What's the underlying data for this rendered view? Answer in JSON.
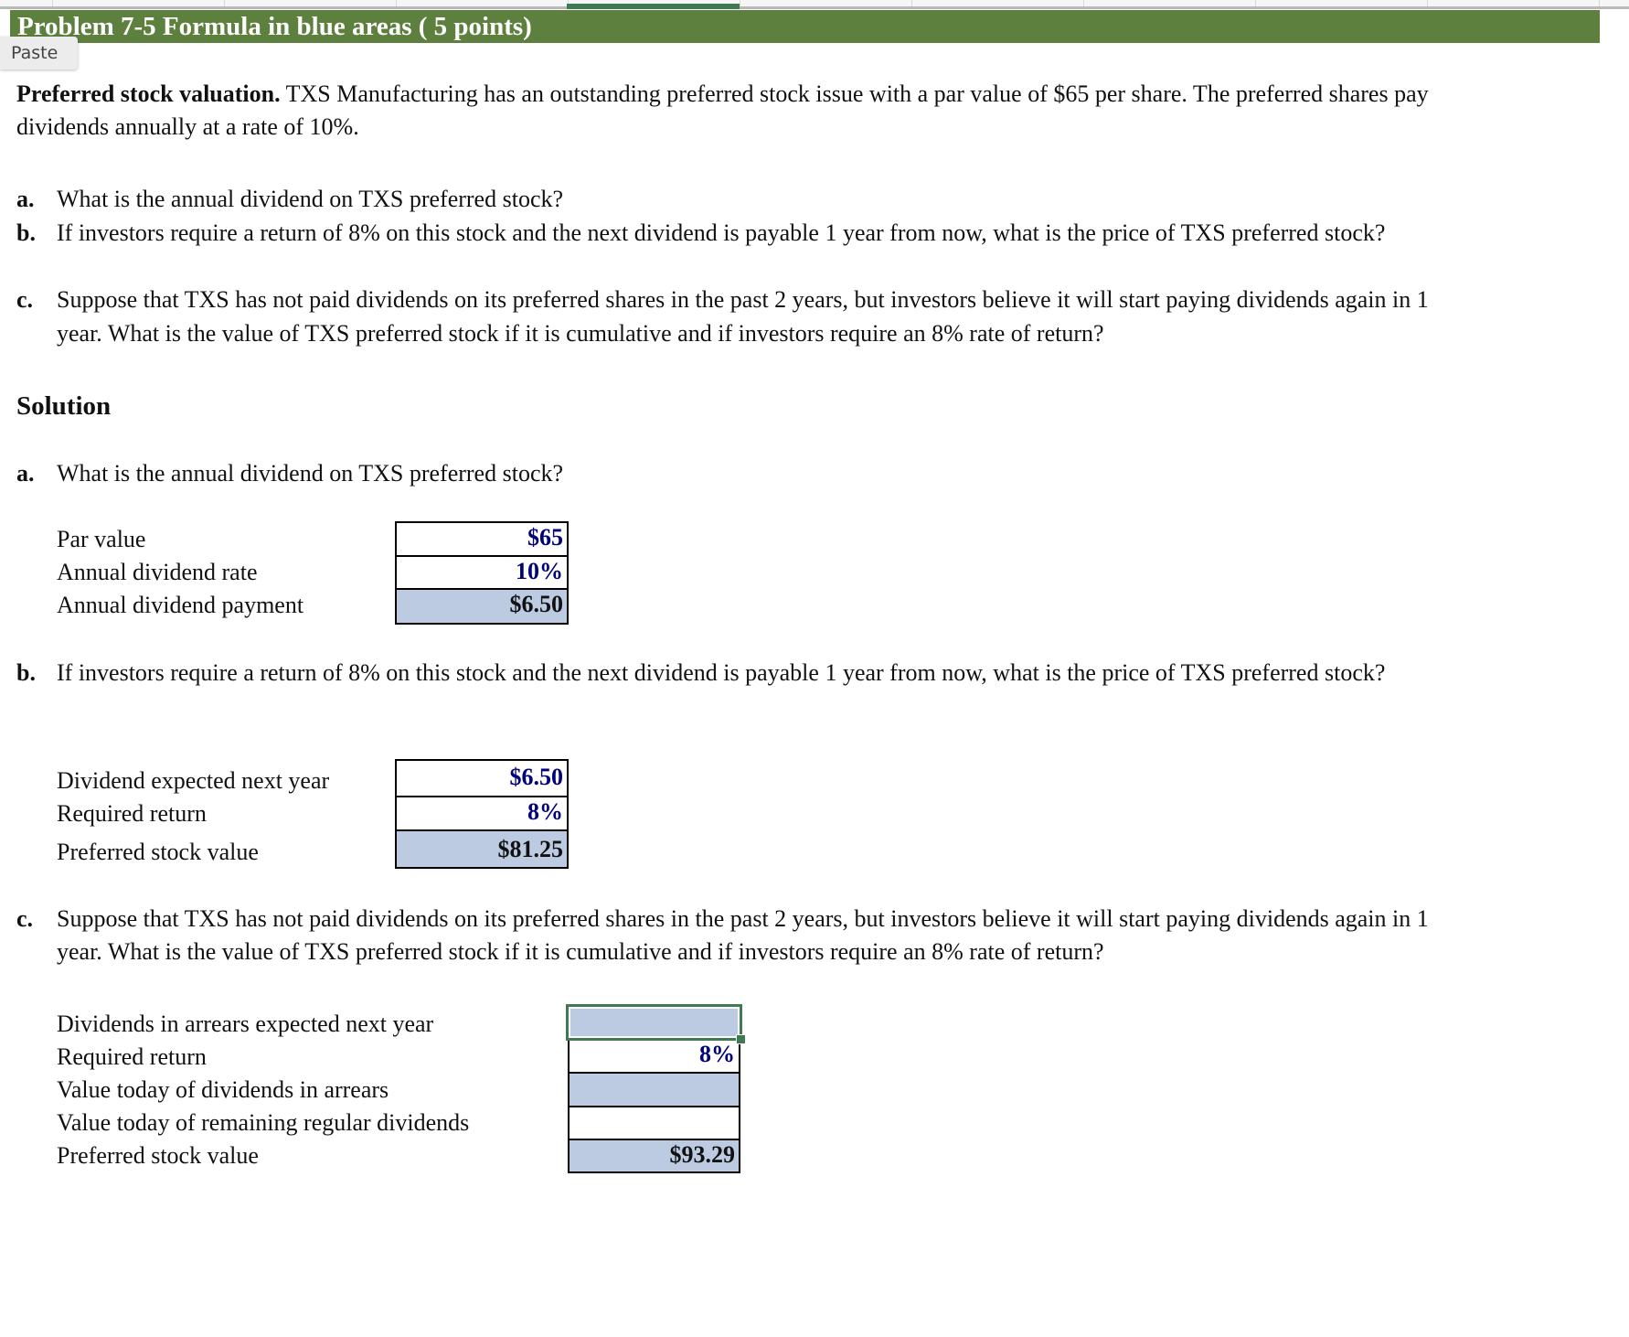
{
  "spreadsheet": {
    "banner_title": "Problem 7-5  Formula in blue areas ( 5 points)",
    "paste_button": "Paste"
  },
  "problem": {
    "intro_bold": "Preferred stock valuation.",
    "intro_line1": " TXS Manufacturing has an outstanding preferred stock issue with a par value of $65 per share. The preferred shares pay",
    "intro_line2": "dividends annually at a rate of 10%.",
    "questions": [
      {
        "label": "a.",
        "lines": [
          "What is the annual dividend on TXS preferred stock?"
        ]
      },
      {
        "label": "b.",
        "lines": [
          "If investors require a return of 8% on this stock and the next dividend is payable 1 year from now, what is the price of TXS preferred stock?"
        ]
      },
      {
        "label": "c.",
        "lines": [
          "Suppose that TXS has not paid dividends on its preferred shares in the past 2 years, but investors believe it will start paying dividends again in 1",
          "year. What is the value of TXS preferred stock if it is cumulative and if investors require an 8% rate of return?"
        ]
      }
    ]
  },
  "solution": {
    "heading": "Solution",
    "part_a": {
      "label": "a.",
      "question": "What is the annual dividend on TXS preferred stock?",
      "rows": [
        {
          "label": "Par value",
          "value": "$65",
          "type": "input"
        },
        {
          "label": "Annual dividend rate",
          "value": "10%",
          "type": "input"
        },
        {
          "label": "Annual dividend payment",
          "value": "$6.50",
          "type": "formula"
        }
      ]
    },
    "part_b": {
      "label": "b.",
      "question": "If investors require a return of 8% on this stock and the next dividend is payable 1 year from now, what is the price of TXS preferred stock?",
      "rows": [
        {
          "label": "Dividend expected next year",
          "value": "$6.50",
          "type": "input"
        },
        {
          "label": "Required return",
          "value": "8%",
          "type": "input"
        },
        {
          "label": "Preferred stock value",
          "value": "$81.25",
          "type": "formula"
        }
      ]
    },
    "part_c": {
      "label": "c.",
      "question_line1": "Suppose that TXS has not paid dividends on its preferred shares in the past 2 years, but investors believe it will start paying dividends again in 1",
      "question_line2": "year. What is the value of TXS preferred stock if it is cumulative and if investors require an 8% rate of return?",
      "rows": [
        {
          "label": "Dividends in arrears expected next year",
          "value": "",
          "type": "formula",
          "selected": true
        },
        {
          "label": "Required return",
          "value": "8%",
          "type": "input"
        },
        {
          "label": "Value today of dividends in arrears",
          "value": "",
          "type": "formula"
        },
        {
          "label": "Value today of remaining regular dividends",
          "value": "",
          "type": "input"
        },
        {
          "label": "Preferred stock value",
          "value": "$93.29",
          "type": "formula"
        }
      ]
    }
  },
  "colors": {
    "banner": "#5e803e",
    "formula_cell": "#bccbe2",
    "input_text": "#00007a",
    "selection": "#3f7a52"
  }
}
